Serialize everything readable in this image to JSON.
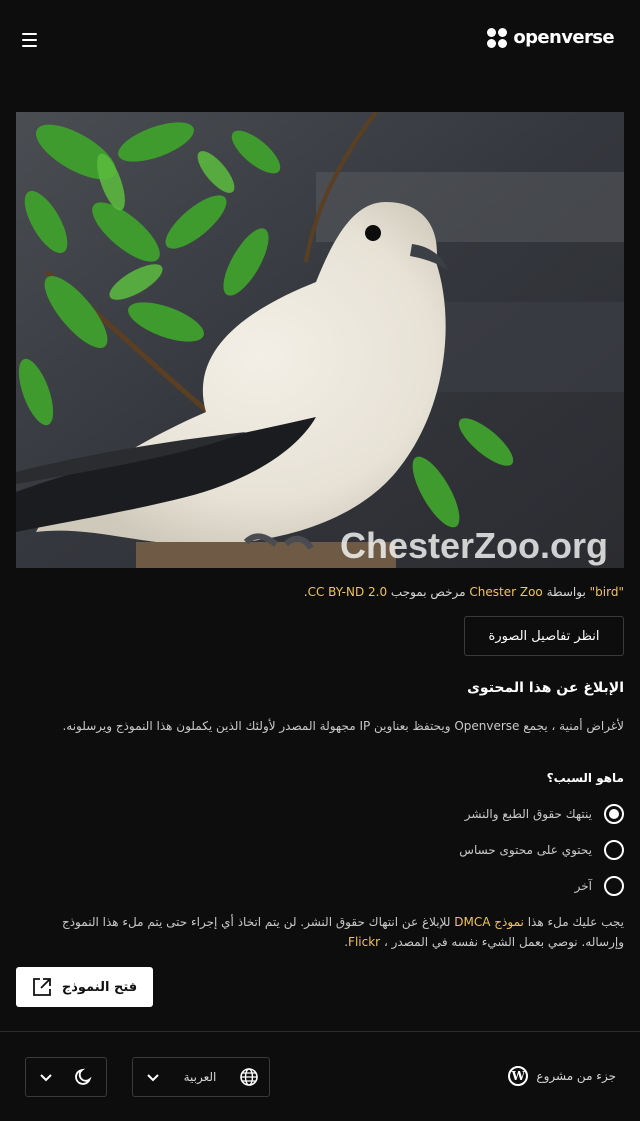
{
  "header": {
    "menu_icon": "hamburger-menu-icon",
    "logo_text": "openverse"
  },
  "image": {
    "watermark": "ChesterZoo.org"
  },
  "attribution": {
    "title_link": "\"bird\"",
    "by_text": "بواسطة",
    "author_link": "Chester Zoo",
    "license_prefix": "مرخص بموجب",
    "license_link": "CC BY-ND 2.0",
    "end": "."
  },
  "details_button": "انظر تفاصيل الصورة",
  "report": {
    "title": "الإبلاغ عن هذا المحتوى",
    "description": "لأغراض أمنية ، يجمع Openverse ويحتفظ بعناوين IP مجهولة المصدر لأولئك الذين يكملون هذا النموذج ويرسلونه.",
    "reason_question": "ماهو السبب؟",
    "reasons": [
      {
        "label": "ينتهك حقوق الطبع والنشر",
        "checked": true
      },
      {
        "label": "يحتوي على محتوى حساس",
        "checked": false
      },
      {
        "label": "آخر",
        "checked": false
      }
    ],
    "dmca_part1": "يجب عليك ملء هذا",
    "dmca_link": "نموذج DMCA",
    "dmca_part2": "للإبلاغ عن انتهاك حقوق النشر. لن يتم اتخاذ أي إجراء حتى يتم ملء هذا النموذج وإرساله. نوصي بعمل الشيء نفسه في المصدر ،",
    "source_link": "Flickr",
    "dmca_end": ".",
    "open_form_button": "فتح النموذج"
  },
  "footer": {
    "part_of": "جزء من مشروع",
    "language": "العربية"
  },
  "colors": {
    "background": "#0d0d0d",
    "link": "#f0c35c",
    "button_light": "#ffffff"
  }
}
